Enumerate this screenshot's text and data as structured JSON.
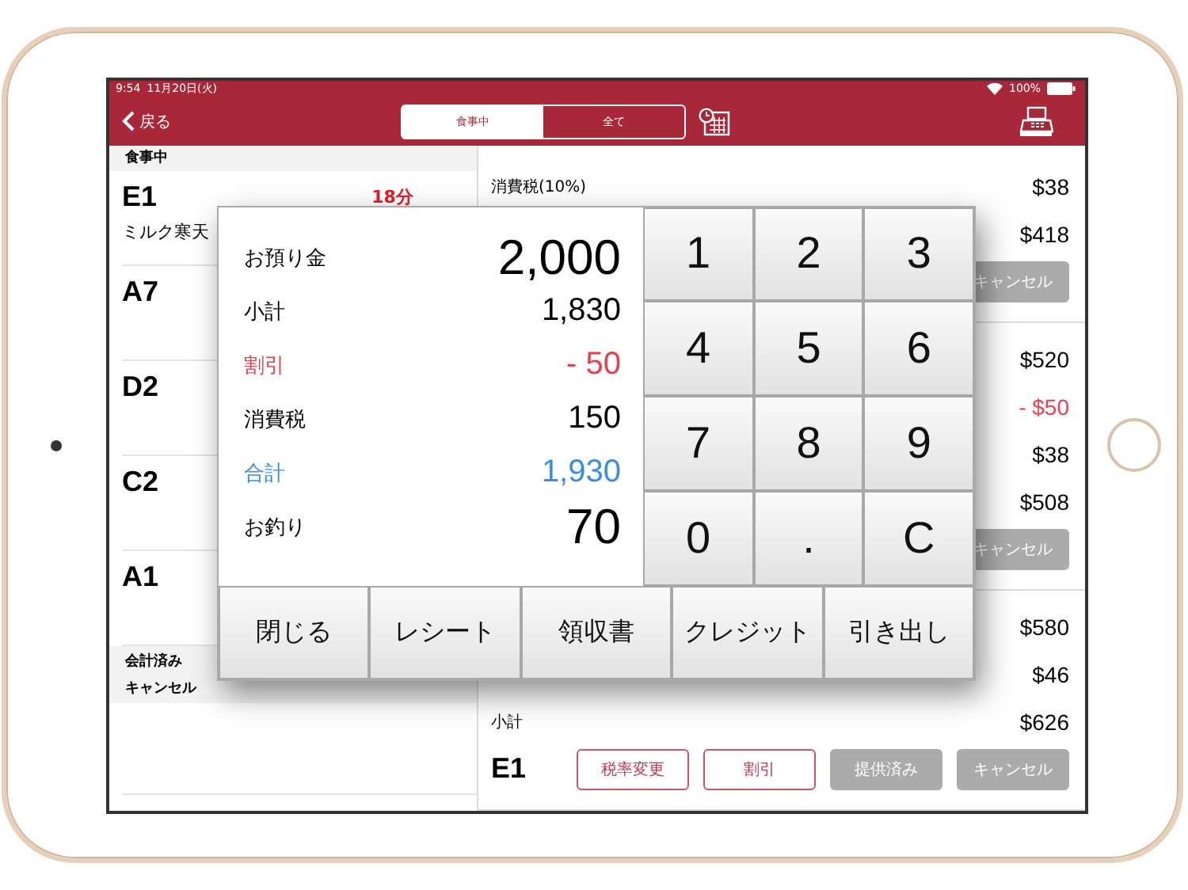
{
  "status_bar": {
    "time": "9:54",
    "date": "11月20日(火)",
    "battery": "100%"
  },
  "nav": {
    "back": "戻る",
    "tabs": [
      {
        "label": "食事中",
        "selected": true
      },
      {
        "label": "全て",
        "selected": false
      }
    ]
  },
  "table_list": {
    "header": "食事中",
    "tables": [
      {
        "name": "E1",
        "elapsed": "18分",
        "items": "ミルク寒天"
      },
      {
        "name": "A7"
      },
      {
        "name": "D2"
      },
      {
        "name": "C2"
      },
      {
        "name": "A1"
      }
    ],
    "other_sections": [
      "会計済み",
      "キャンセル"
    ]
  },
  "order_panel": {
    "groups": [
      {
        "rows": [
          {
            "label": "消費税(10%)",
            "value": "$38",
            "kind": "normal"
          },
          {
            "value": "$418",
            "kind": "normal"
          }
        ],
        "buttons": [
          {
            "label": "キャンセル",
            "kind": "disabled"
          }
        ]
      },
      {
        "rows": [
          {
            "value": "$520",
            "kind": "normal"
          },
          {
            "value": "- $50",
            "kind": "discount"
          },
          {
            "value": "$38",
            "kind": "normal"
          },
          {
            "value": "$508",
            "kind": "normal"
          }
        ],
        "buttons": [
          {
            "label": "キャンセル",
            "kind": "disabled"
          }
        ]
      },
      {
        "rows": [
          {
            "value": "$580",
            "kind": "normal"
          },
          {
            "value": "$46",
            "kind": "normal"
          },
          {
            "label": "小計",
            "value": "$626",
            "kind": "normal"
          }
        ],
        "table": "E1",
        "buttons": [
          {
            "label": "税率変更",
            "kind": "outline"
          },
          {
            "label": "割引",
            "kind": "outline"
          },
          {
            "label": "提供済み",
            "kind": "disabled"
          },
          {
            "label": "キャンセル",
            "kind": "disabled"
          }
        ]
      }
    ]
  },
  "payment_dialog": {
    "lines": [
      {
        "label": "お預り金",
        "value": "2,000",
        "kind": "large"
      },
      {
        "label": "小計",
        "value": "1,830",
        "kind": "normal"
      },
      {
        "label": "割引",
        "value": "- 50",
        "kind": "discount"
      },
      {
        "label": "消費税",
        "value": "150",
        "kind": "normal"
      },
      {
        "label": "合計",
        "value": "1,930",
        "kind": "total"
      },
      {
        "label": "お釣り",
        "value": "70",
        "kind": "large"
      }
    ],
    "keypad": [
      "1",
      "2",
      "3",
      "4",
      "5",
      "6",
      "7",
      "8",
      "9",
      "0",
      ".",
      "C"
    ],
    "actions": [
      "閉じる",
      "レシート",
      "領収書",
      "クレジット",
      "引き出し"
    ]
  }
}
